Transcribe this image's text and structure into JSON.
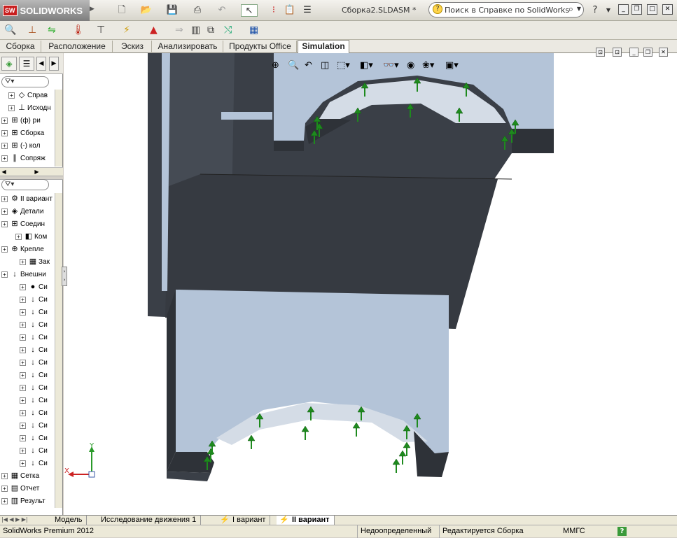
{
  "app": {
    "logo_text": "SOLIDWORKS",
    "logo_mark": "SW",
    "doc_title": "Сборка2.SLDASM *"
  },
  "search": {
    "placeholder": "Поиск в Справке по SolidWorks"
  },
  "command_tabs": [
    "Сборка",
    "Расположение",
    "Эскиз",
    "Анализировать",
    "Продукты Office",
    "Simulation"
  ],
  "active_command_tab": "Simulation",
  "tree_top": [
    {
      "label": "Справ",
      "icon": "◇"
    },
    {
      "label": "Исходн",
      "icon": "⊥"
    },
    {
      "label": "(ф) ри",
      "icon": "⊞"
    },
    {
      "label": "Сборка",
      "icon": "⊞"
    },
    {
      "label": "(-) кол",
      "icon": "⊞"
    },
    {
      "label": "Сопряж",
      "icon": "∥"
    }
  ],
  "tree_sim": [
    {
      "label": "II вариант",
      "icon": "⚙"
    },
    {
      "label": "Детали",
      "icon": "◈"
    },
    {
      "label": "Соедин",
      "icon": "⊞"
    },
    {
      "label": "Ком",
      "icon": "◧"
    },
    {
      "label": "Крепле",
      "icon": "⊕"
    },
    {
      "label": "Зак",
      "icon": "▦"
    },
    {
      "label": "Внешни",
      "icon": "↓"
    },
    {
      "label": "Си",
      "icon": "●"
    },
    {
      "label": "Си",
      "icon": "↓"
    },
    {
      "label": "Си",
      "icon": "↓"
    },
    {
      "label": "Си",
      "icon": "↓"
    },
    {
      "label": "Си",
      "icon": "↓"
    },
    {
      "label": "Си",
      "icon": "↓"
    },
    {
      "label": "Си",
      "icon": "↓"
    },
    {
      "label": "Си",
      "icon": "↓"
    },
    {
      "label": "Си",
      "icon": "↓"
    },
    {
      "label": "Си",
      "icon": "↓"
    },
    {
      "label": "Си",
      "icon": "↓"
    },
    {
      "label": "Си",
      "icon": "↓"
    },
    {
      "label": "Си",
      "icon": "↓"
    },
    {
      "label": "Си",
      "icon": "↓"
    },
    {
      "label": "Си",
      "icon": "↓"
    },
    {
      "label": "Сетка",
      "icon": "▦"
    },
    {
      "label": "Отчет",
      "icon": "▤"
    },
    {
      "label": "Результ",
      "icon": "▥"
    }
  ],
  "bottom_tabs": [
    "Модель",
    "Исследование движения 1",
    "I вариант",
    "II вариант"
  ],
  "active_bottom_tab": "II вариант",
  "status": {
    "product": "SolidWorks Premium 2012",
    "state": "Недоопределенный",
    "editing": "Редактируется Сборка",
    "units": "ММГС"
  },
  "triad": {
    "x": "X",
    "y": "Y"
  },
  "colors": {
    "part_top": "#b4c4d8",
    "part_side": "#3a3f47",
    "load_arrow": "#1e8a1e"
  }
}
